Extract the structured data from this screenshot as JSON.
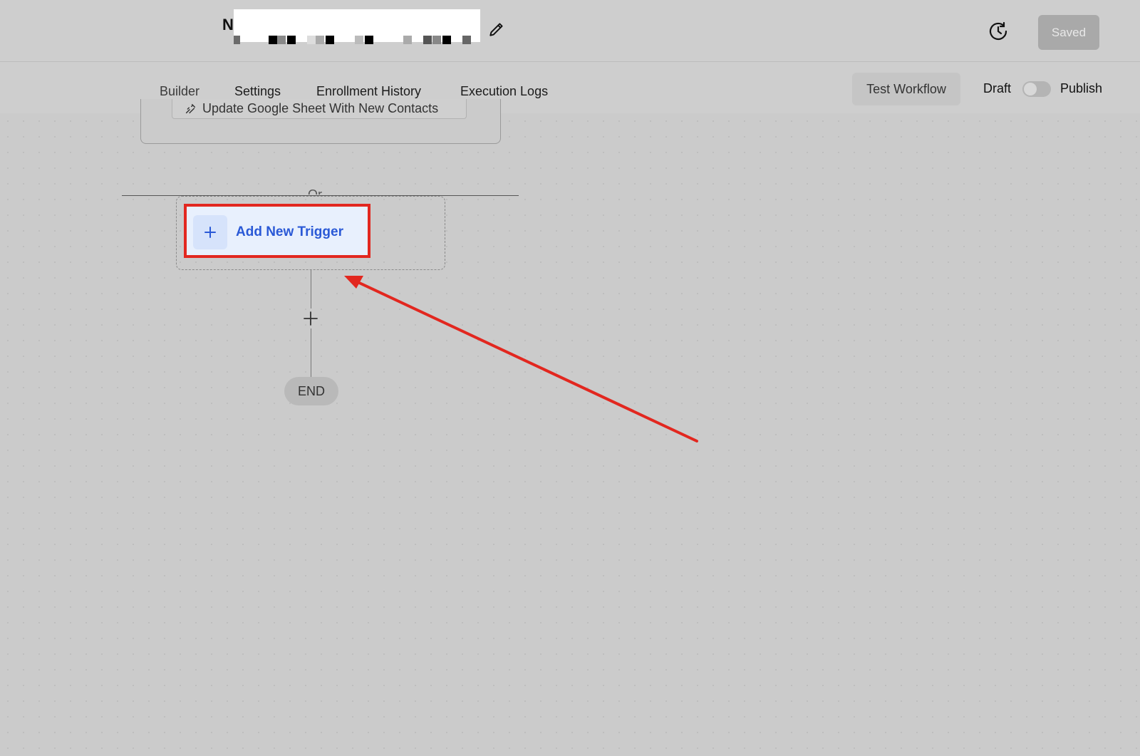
{
  "header": {
    "workflow_name_initial": "N",
    "saved_label": "Saved"
  },
  "tabs": [
    {
      "label": "Builder",
      "active": true
    },
    {
      "label": "Settings",
      "active": false
    },
    {
      "label": "Enrollment History",
      "active": false
    },
    {
      "label": "Execution Logs",
      "active": false
    }
  ],
  "actions": {
    "test_workflow_label": "Test Workflow",
    "draft_label": "Draft",
    "publish_label": "Publish",
    "publish_toggle_on": false
  },
  "canvas": {
    "trigger_label": "Update Google Sheet With New Contacts",
    "or_label": "Or",
    "add_trigger_label": "Add New Trigger",
    "end_label": "END"
  },
  "colors": {
    "accent_blue": "#2a59d6",
    "highlight_red": "#e2271f",
    "saved_button_bg": "#a9a9a9"
  }
}
